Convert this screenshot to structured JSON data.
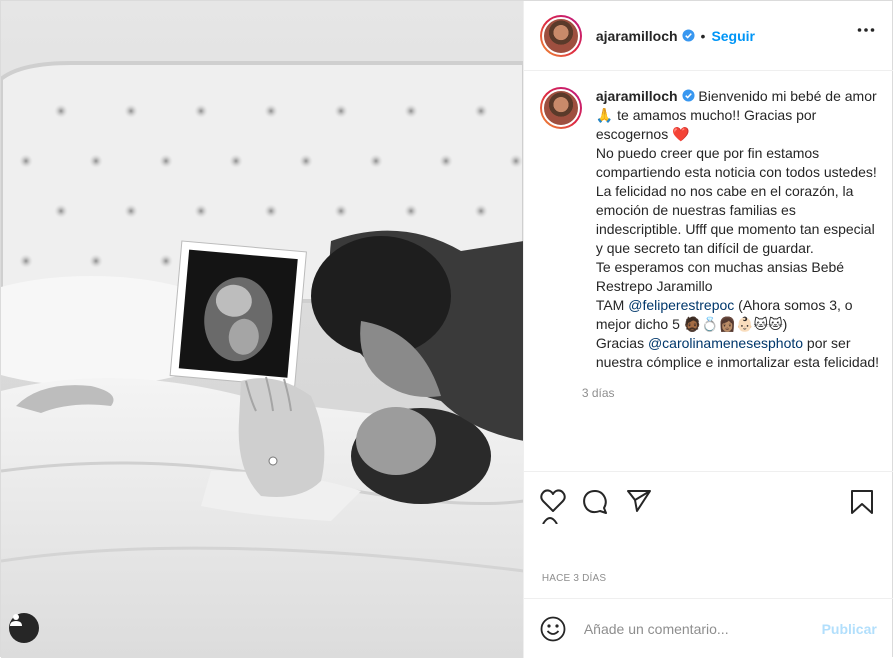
{
  "post": {
    "username": "ajaramilloch",
    "follow_label": "Seguir",
    "separator": "•",
    "caption": {
      "username": "ajaramilloch",
      "part1": " Bienvenido mi bebé de amor 🙏 te amamos mucho!! Gracias por escogernos ",
      "heart": "❤️",
      "part2": "\nNo puedo creer que por fin estamos compartiendo esta noticia con todos ustedes! La felicidad no nos cabe en el corazón, la emoción de nuestras familias es indescriptible. Ufff que momento tan especial y que secreto tan difícil de guardar.\nTe esperamos con muchas ansias Bebé Restrepo Jaramillo\nTAM ",
      "mention1": "@feliperestrepoc",
      "part3": " (Ahora somos 3, o mejor dicho 5 🧔🏾💍👩🏽👶🏻🐱🐱)\nGracias ",
      "mention2": "@carolinamenesesphoto",
      "part4": " por ser nuestra cómplice e inmortalizar esta felicidad!",
      "time": "3 días"
    },
    "date": "HACE 3 DÍAS",
    "comment_placeholder": "Añade un comentario...",
    "publish_label": "Publicar"
  },
  "colors": {
    "accent": "#0095f6",
    "publish_disabled": "#b2dffc",
    "secondary_text": "#8e8e8e",
    "mention": "#00376b"
  },
  "icons": [
    "user-tag-icon",
    "verified-badge-icon",
    "more-options-icon",
    "like-heart-icon",
    "comment-icon",
    "share-icon",
    "save-bookmark-icon",
    "emoji-icon"
  ]
}
